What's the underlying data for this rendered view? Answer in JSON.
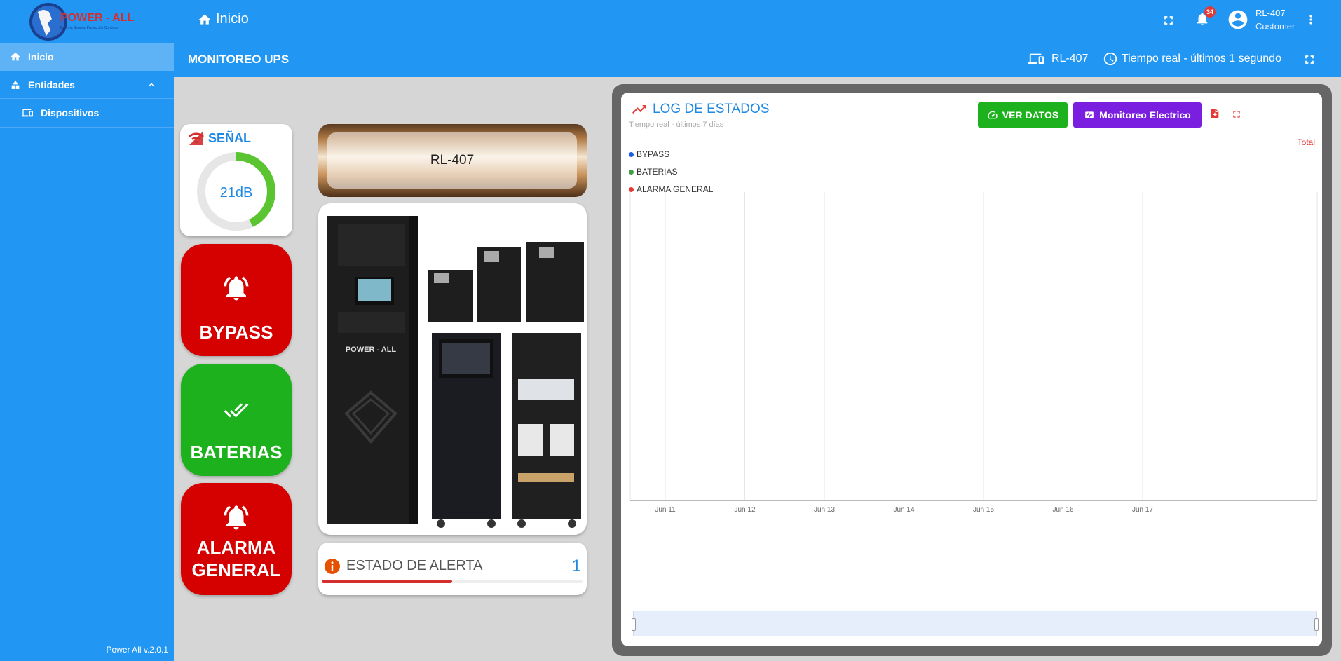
{
  "brand": {
    "name": "POWER - ALL",
    "tagline": "Energía Segura, Protección Continua"
  },
  "topbar": {
    "title": "Inicio",
    "notifications": "34",
    "user_name": "RL-407",
    "user_role": "Customer"
  },
  "sidebar": {
    "items": [
      {
        "label": "Inicio",
        "icon": "home-icon"
      },
      {
        "label": "Entidades",
        "icon": "entities-icon"
      },
      {
        "label": "Dispositivos",
        "icon": "devices-icon"
      }
    ],
    "version": "Power All v.2.0.1"
  },
  "subbar": {
    "title": "MONITOREO UPS",
    "device": "RL-407",
    "timewindow": "Tiempo real - últimos 1 segundo"
  },
  "signal": {
    "title": "SEÑAL",
    "value": "21dB",
    "level": 0.43
  },
  "status_buttons": {
    "bypass": "BYPASS",
    "baterias": "BATERIAS",
    "alarma_line1": "ALARMA",
    "alarma_line2": "GENERAL"
  },
  "device_card": {
    "name": "RL-407",
    "product_brand": "POWER - ALL"
  },
  "alert": {
    "title": "ESTADO DE ALERTA",
    "value": "1",
    "level": 0.5
  },
  "log": {
    "title": "LOG DE ESTADOS",
    "subtitle": "Tiempo real - últimos 7 días",
    "ver_datos": "VER DATOS",
    "monitoreo": "Monitoreo Electrico",
    "total": "Total"
  },
  "colors": {
    "primary": "#2196f3",
    "red": "#d50000",
    "green": "#1db21d",
    "purple": "#7a1fe0"
  },
  "chart_data": {
    "type": "line",
    "title": "LOG DE ESTADOS",
    "x_ticks": [
      "Jun 11",
      "Jun 12",
      "Jun 13",
      "Jun 14",
      "Jun 15",
      "Jun 16",
      "Jun 17"
    ],
    "series": [
      {
        "name": "BYPASS",
        "color": "#1e5de8",
        "values": []
      },
      {
        "name": "BATERIAS",
        "color": "#43a047",
        "values": []
      },
      {
        "name": "ALARMA GENERAL",
        "color": "#e53935",
        "values": []
      }
    ],
    "legend": "top-left",
    "grid": true
  }
}
